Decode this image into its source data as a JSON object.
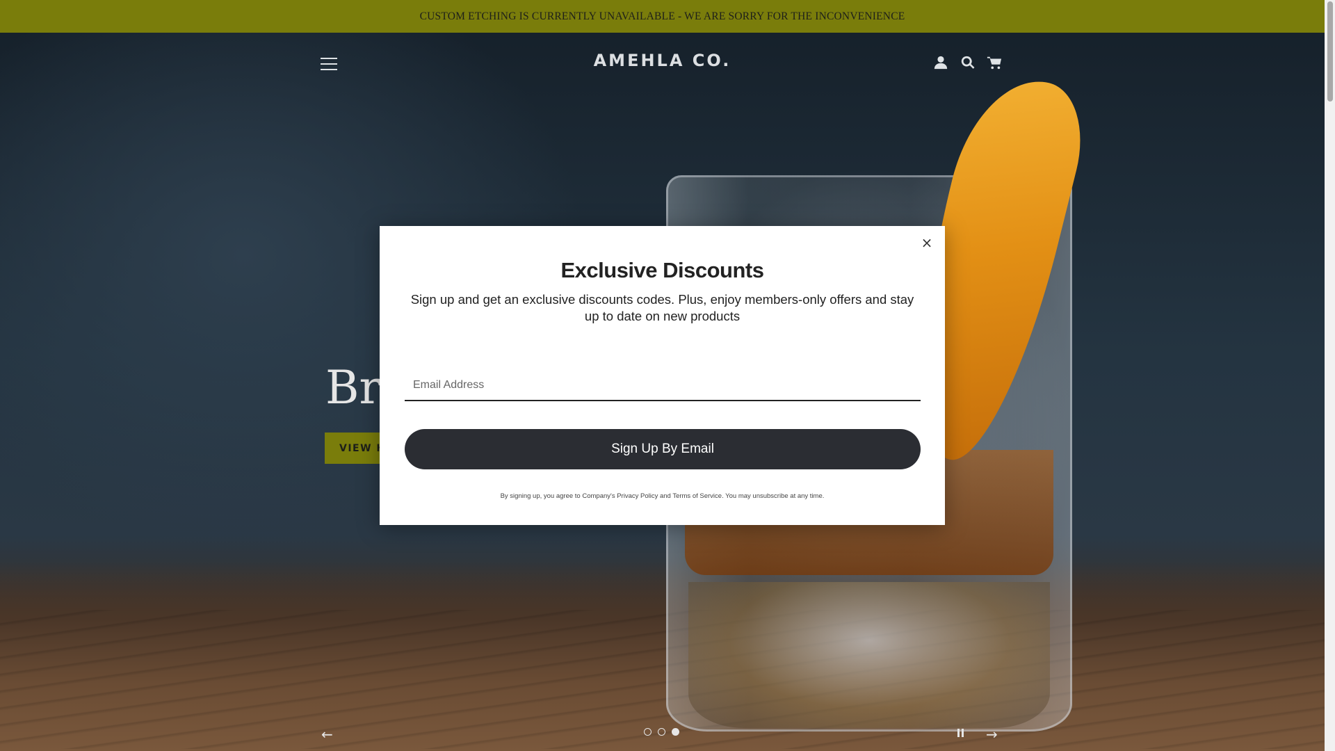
{
  "announcement": {
    "text": "CUSTOM ETCHING IS CURRENTLY UNAVAILABLE - WE ARE SORRY FOR THE INCONVENIENCE"
  },
  "header": {
    "logo": "AMEHLA CO.",
    "icons": [
      "menu-icon",
      "account-icon",
      "search-icon",
      "cart-icon"
    ]
  },
  "hero": {
    "title_visible": "Bri",
    "button_visible": "VIEW H",
    "slides": {
      "count": 3,
      "active_index": 2
    }
  },
  "popup": {
    "title": "Exclusive Discounts",
    "description": "Sign up and get an exclusive discounts codes. Plus, enjoy members-only offers and stay up to date on new products",
    "email_placeholder": "Email Address",
    "button_label": "Sign Up By Email",
    "close_symbol": "×",
    "legal_prefix": "By signing up, you agree to Company's",
    "privacy_link": "Privacy Policy",
    "legal_and": "and",
    "terms_link": "Terms of Service",
    "legal_suffix": ". You may unsubscribe at any time."
  },
  "slider_controls": {
    "prev_symbol": "←",
    "next_symbol": "→"
  },
  "colors": {
    "announcement_bg": "#7a7d0b",
    "button_dark": "#2b2d33",
    "modal_bg": "#ffffff"
  }
}
